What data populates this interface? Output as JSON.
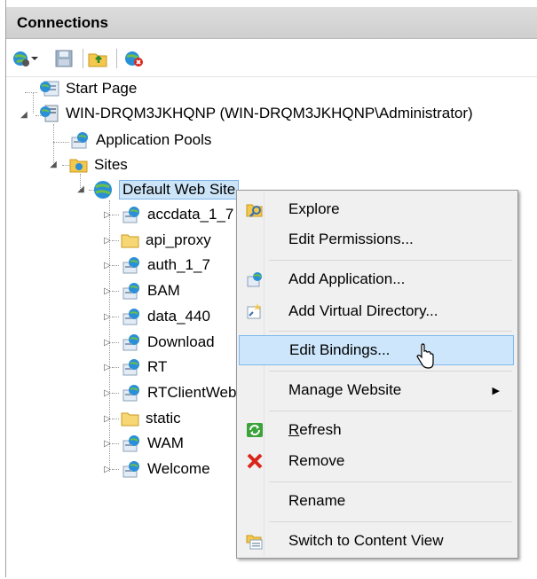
{
  "header": {
    "title": "Connections"
  },
  "tree": {
    "start_page": "Start Page",
    "server": "WIN-DRQM3JKHQNP (WIN-DRQM3JKHQNP\\Administrator)",
    "app_pools": "Application Pools",
    "sites": "Sites",
    "default_site": "Default Web Site",
    "children": [
      {
        "label": "accdata_1_7",
        "kind": "app"
      },
      {
        "label": "api_proxy",
        "kind": "folder"
      },
      {
        "label": "auth_1_7",
        "kind": "app"
      },
      {
        "label": "BAM",
        "kind": "app"
      },
      {
        "label": "data_440",
        "kind": "app"
      },
      {
        "label": "Download",
        "kind": "app"
      },
      {
        "label": "RT",
        "kind": "app"
      },
      {
        "label": "RTClientWeb",
        "kind": "app"
      },
      {
        "label": "static",
        "kind": "folder"
      },
      {
        "label": "WAM",
        "kind": "app"
      },
      {
        "label": "Welcome",
        "kind": "app"
      }
    ]
  },
  "menu": {
    "explore": "Explore",
    "edit_permissions": "Edit Permissions...",
    "add_application": "Add Application...",
    "add_virtual_directory": "Add Virtual Directory...",
    "edit_bindings": "Edit Bindings...",
    "manage_website": "Manage Website",
    "refresh_first": "R",
    "refresh_rest": "efresh",
    "remove": "Remove",
    "rename": "Rename",
    "switch_content": "Switch to Content View"
  },
  "colors": {
    "selection": "#cce4f7",
    "hover": "#cde6fb",
    "remove_red": "#d9261c"
  }
}
